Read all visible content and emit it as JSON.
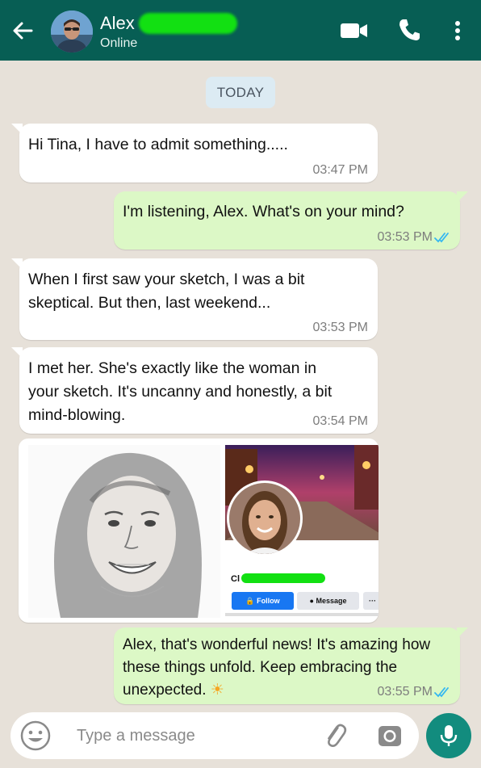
{
  "header": {
    "contact_name": "Alex",
    "status": "Online"
  },
  "date_chip": "TODAY",
  "messages": [
    {
      "direction": "incoming",
      "text": "Hi Tina, I have to admit something.....",
      "time": "03:47 PM"
    },
    {
      "direction": "outgoing",
      "text": "I'm listening, Alex. What's on your mind?",
      "time": "03:53 PM",
      "read": true
    },
    {
      "direction": "incoming",
      "text": "When I first saw your sketch, I was a bit skeptical. But then, last weekend...",
      "time": "03:53 PM"
    },
    {
      "direction": "incoming",
      "text": "I met her. She's exactly like the woman in your sketch. It's uncanny and honestly, a bit mind-blowing.",
      "time": "03:54 PM"
    },
    {
      "direction": "outgoing",
      "text": "Alex, that's wonderful news! It's amazing how these things unfold. Keep embracing the unexpected.",
      "emoji": "☀",
      "time": "03:55 PM",
      "read": true
    }
  ],
  "image_message": {
    "profile_name_visible": "Cl",
    "follow_label": "Follow",
    "message_label": "Message",
    "more_label": "···"
  },
  "composer": {
    "placeholder": "Type a message"
  },
  "colors": {
    "header": "#075e54",
    "outgoing_bubble": "#dcf8c6",
    "incoming_bubble": "#ffffff",
    "read_ticks": "#34b7f1",
    "mic_button": "#128c7e",
    "fb_follow": "#1877f2"
  },
  "icons": [
    "back-arrow-icon",
    "video-call-icon",
    "phone-icon",
    "more-vertical-icon",
    "emoji-icon",
    "attach-clip-icon",
    "camera-icon",
    "mic-icon",
    "double-check-icon"
  ]
}
